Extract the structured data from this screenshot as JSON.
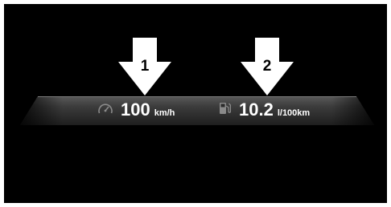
{
  "callouts": [
    {
      "number": "1"
    },
    {
      "number": "2"
    }
  ],
  "display": {
    "speed": {
      "icon": "speedometer-icon",
      "value": "100",
      "unit": "km/h"
    },
    "fuel": {
      "icon": "fuel-pump-icon",
      "value": "10.2",
      "unit": "l/100km"
    }
  },
  "colors": {
    "background": "#000000",
    "bar": "#3a3a3a",
    "arrow": "#ffffff",
    "text": "#ffffff"
  }
}
